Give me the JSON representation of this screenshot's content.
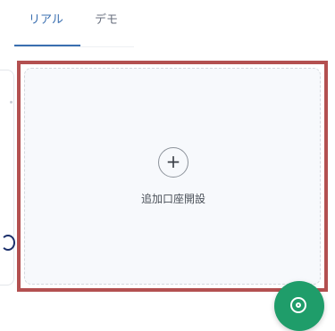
{
  "tabs": [
    {
      "label": "リアル",
      "active": true
    },
    {
      "label": "デモ",
      "active": false
    }
  ],
  "add_account_card": {
    "icon": "plus-icon",
    "icon_glyph": "+",
    "label": "追加口座開設"
  },
  "fab": {
    "icon": "support-icon"
  },
  "colors": {
    "accent": "#3a6fb0",
    "highlight": "#b35050",
    "fab": "#1f9d6a",
    "card_bg": "#f7f9fc"
  }
}
